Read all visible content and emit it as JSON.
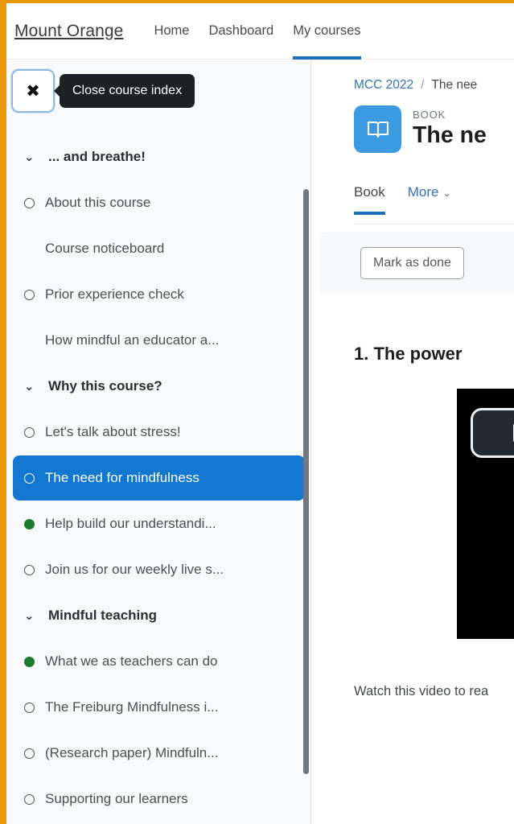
{
  "theme": {
    "frame_color": "#e8960c",
    "accent_blue": "#1d6fb8",
    "link_blue": "#2f73b6",
    "selected_blue": "#1177d1",
    "complete_green": "#1d7a2e",
    "book_icon_blue": "#3c9ae2",
    "tooltip_bg": "#1d2125"
  },
  "topnav": {
    "brand": "Mount Orange",
    "links": [
      {
        "label": "Home",
        "active": false
      },
      {
        "label": "Dashboard",
        "active": false
      },
      {
        "label": "My courses",
        "active": true
      }
    ]
  },
  "drawer": {
    "close_button": {
      "glyph": "✖",
      "icon_name": "close-icon"
    },
    "tooltip": "Close course index",
    "scrollbar": {
      "visible": true
    },
    "sections": [
      {
        "label": "... and breathe!",
        "chevron": "⌄",
        "items": [
          {
            "label": "About this course",
            "status": "incomplete",
            "selected": false
          },
          {
            "label": "Course noticeboard",
            "status": "none",
            "selected": false
          },
          {
            "label": "Prior experience check",
            "status": "incomplete",
            "selected": false
          },
          {
            "label": "How mindful an educator a...",
            "status": "none",
            "selected": false
          }
        ]
      },
      {
        "label": "Why this course?",
        "chevron": "⌄",
        "items": [
          {
            "label": "Let's talk about stress!",
            "status": "incomplete",
            "selected": false
          },
          {
            "label": "The need for mindfulness",
            "status": "incomplete",
            "selected": true
          },
          {
            "label": "Help build our understandi...",
            "status": "complete",
            "selected": false
          },
          {
            "label": "Join us for our weekly live s...",
            "status": "incomplete",
            "selected": false
          }
        ]
      },
      {
        "label": "Mindful teaching",
        "chevron": "⌄",
        "items": [
          {
            "label": "What we as teachers can do",
            "status": "complete",
            "selected": false
          },
          {
            "label": "The Freiburg Mindfulness i...",
            "status": "incomplete",
            "selected": false
          },
          {
            "label": "(Research paper) Mindfuln...",
            "status": "incomplete",
            "selected": false
          },
          {
            "label": "Supporting our learners",
            "status": "incomplete",
            "selected": false
          }
        ]
      }
    ]
  },
  "main": {
    "breadcrumb": {
      "course_link": "MCC 2022",
      "separator": "/",
      "current": "The nee"
    },
    "activity": {
      "kind": "BOOK",
      "title": "The ne",
      "icon_name": "book-icon"
    },
    "tabs": [
      {
        "label": "Book",
        "active": true
      },
      {
        "label": "More",
        "active": false,
        "caret": "⌄"
      }
    ],
    "completion": {
      "mark_as_done": "Mark as done"
    },
    "chapter_title": "1. The power",
    "video": {
      "play_label": "play-button"
    },
    "paragraph": "Watch this video to rea"
  }
}
